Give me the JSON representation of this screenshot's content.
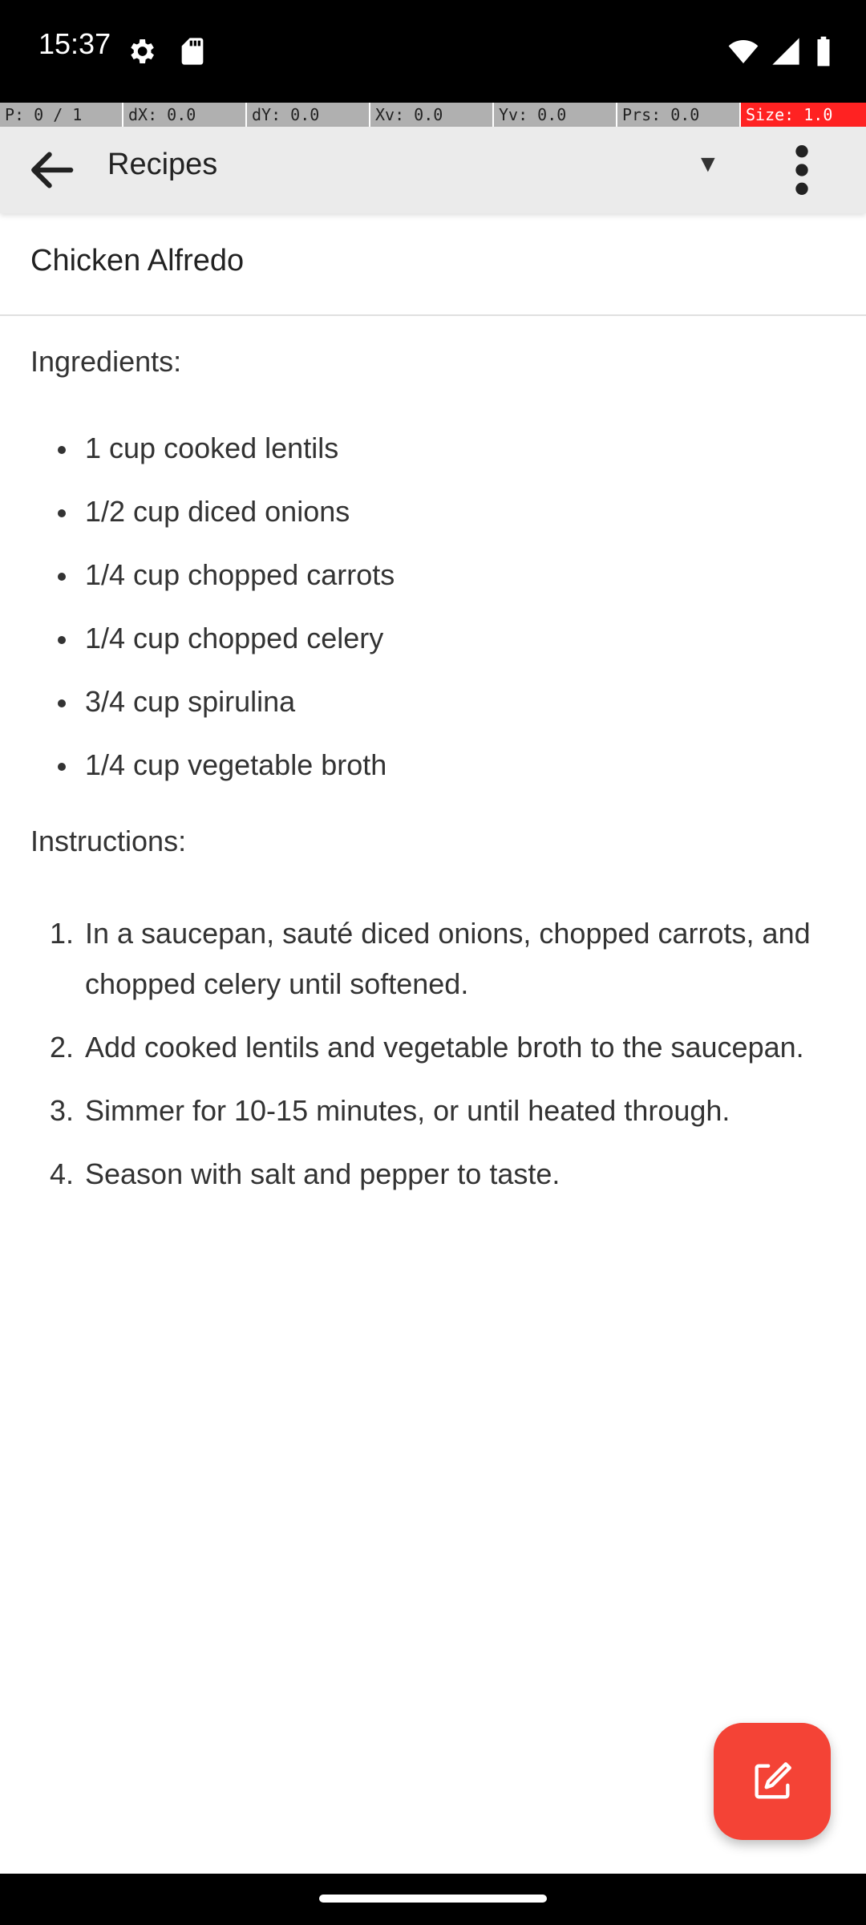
{
  "status_bar": {
    "time": "15:37",
    "left_icons": [
      "settings-gear-icon",
      "sd-card-icon"
    ],
    "right_icons": [
      "wifi-icon",
      "signal-icon",
      "battery-icon"
    ]
  },
  "debug_bar": {
    "segments": [
      "P: 0 / 1",
      "dX: 0.0",
      "dY: 0.0",
      "Xv: 0.0",
      "Yv: 0.0",
      "Prs: 0.0",
      "Size: 1.0"
    ]
  },
  "app_bar": {
    "title": "Recipes",
    "back_icon": "arrow-back-icon",
    "dropdown_icon": "▼",
    "overflow_icon": "more-vert-icon"
  },
  "note": {
    "title": "Chicken Alfredo",
    "ingredients_label": "Ingredients:",
    "ingredients": [
      "1 cup cooked lentils",
      "1/2 cup diced onions",
      "1/4 cup chopped carrots",
      "1/4 cup chopped celery",
      "3/4 cup spirulina",
      "1/4 cup vegetable broth"
    ],
    "instructions_label": "Instructions:",
    "instructions": [
      "In a saucepan, sauté diced onions, chopped carrots, and chopped celery until softened.",
      "Add cooked lentils and vegetable broth to the saucepan.",
      "Simmer for 10-15 minutes, or until heated through.",
      "Season with salt and pepper to taste."
    ]
  },
  "fab": {
    "icon": "edit-icon",
    "color": "#f44336"
  },
  "colors": {
    "app_bar": "#ebebeb",
    "accent": "#f44336",
    "text": "#333333"
  }
}
